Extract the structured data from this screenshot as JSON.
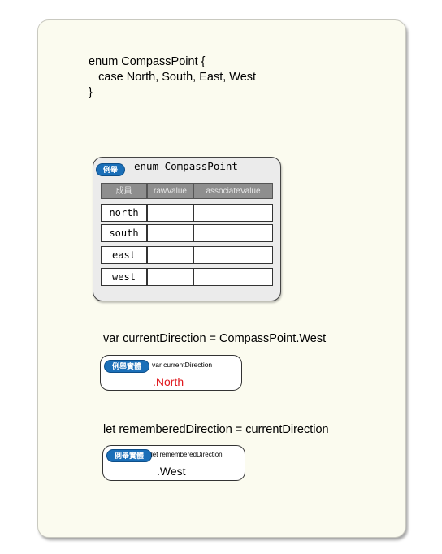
{
  "code": {
    "line1": "enum CompassPoint {",
    "line2": "   case North, South, East, West",
    "line3": "}"
  },
  "enum_table": {
    "badge": "例舉",
    "title": "enum CompassPoint",
    "headers": [
      "成員",
      "rawValue",
      "associateValue"
    ],
    "rows": [
      {
        "member": "north",
        "rawValue": "",
        "associateValue": ""
      },
      {
        "member": "south",
        "rawValue": "",
        "associateValue": ""
      },
      {
        "member": "east",
        "rawValue": "",
        "associateValue": ""
      },
      {
        "member": "west",
        "rawValue": "",
        "associateValue": ""
      }
    ]
  },
  "instance1": {
    "statement": "var currentDirection = CompassPoint.West",
    "badge": "例舉實體",
    "label": "var currentDirection",
    "value": ".North",
    "value_color": "#e0191e"
  },
  "instance2": {
    "statement": "let rememberedDirection = currentDirection",
    "badge": "例舉實體",
    "label": "let rememberedDirection",
    "value": ".West",
    "value_color": "#000000"
  },
  "colors": {
    "card_bg": "#fbfbef",
    "badge_blue": "#1b6fb8",
    "table_header": "#8e8e8e"
  }
}
